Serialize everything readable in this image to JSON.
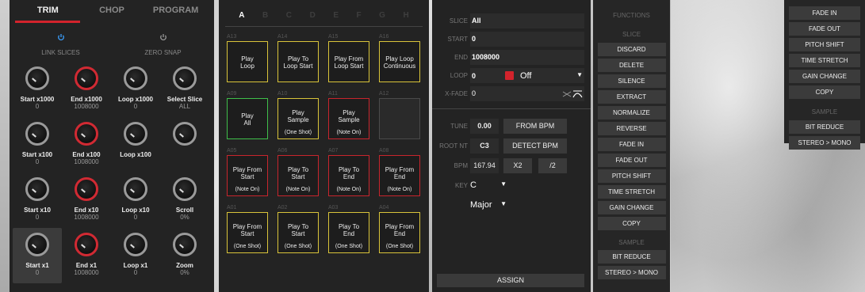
{
  "trim_panel": {
    "tabs": [
      "TRIM",
      "CHOP",
      "PROGRAM"
    ],
    "active_tab": "TRIM",
    "toggles": [
      {
        "label": "LINK SLICES",
        "icon": "power-icon",
        "state": "on",
        "color": "#3aa0ff"
      },
      {
        "label": "ZERO SNAP",
        "icon": "power-icon",
        "state": "off",
        "color": "#9a9a9a"
      }
    ],
    "knobs": [
      {
        "label": "Start x1000",
        "value": "0",
        "accent": "gray"
      },
      {
        "label": "End x1000",
        "value": "1008000",
        "accent": "red"
      },
      {
        "label": "Loop x1000",
        "value": "0",
        "accent": "gray"
      },
      {
        "label": "Select Slice",
        "value": "ALL",
        "accent": "gray"
      },
      {
        "label": "Start x100",
        "value": "0",
        "accent": "gray"
      },
      {
        "label": "End x100",
        "value": "1008000",
        "accent": "red"
      },
      {
        "label": "Loop x100",
        "value": "",
        "accent": "gray"
      },
      {
        "label": "",
        "value": "",
        "accent": "gray"
      },
      {
        "label": "Start x10",
        "value": "0",
        "accent": "gray"
      },
      {
        "label": "End x10",
        "value": "1008000",
        "accent": "red"
      },
      {
        "label": "Loop x10",
        "value": "0",
        "accent": "gray"
      },
      {
        "label": "Scroll",
        "value": "0%",
        "accent": "gray"
      },
      {
        "label": "Start x1",
        "value": "0",
        "accent": "gray"
      },
      {
        "label": "End x1",
        "value": "1008000",
        "accent": "red"
      },
      {
        "label": "Loop x1",
        "value": "0",
        "accent": "gray"
      },
      {
        "label": "Zoom",
        "value": "0%",
        "accent": "gray"
      }
    ],
    "selected_knob": 12
  },
  "pads_panel": {
    "banks": [
      "A",
      "B",
      "C",
      "D",
      "E",
      "F",
      "G",
      "H"
    ],
    "active_bank": "A",
    "pads": [
      {
        "num": "A13",
        "lines": [
          "Play",
          "Loop"
        ],
        "mode": "",
        "color": "yellow"
      },
      {
        "num": "A14",
        "lines": [
          "Play To",
          "Loop Start"
        ],
        "mode": "",
        "color": "yellow"
      },
      {
        "num": "A15",
        "lines": [
          "Play From",
          "Loop Start"
        ],
        "mode": "",
        "color": "yellow"
      },
      {
        "num": "A16",
        "lines": [
          "Play Loop",
          "Continuous"
        ],
        "mode": "",
        "color": "yellow"
      },
      {
        "num": "A09",
        "lines": [
          "Play",
          "All"
        ],
        "mode": "",
        "color": "green"
      },
      {
        "num": "A10",
        "lines": [
          "Play",
          "Sample"
        ],
        "mode": "(One Shot)",
        "color": "yellow"
      },
      {
        "num": "A11",
        "lines": [
          "Play",
          "Sample"
        ],
        "mode": "(Note On)",
        "color": "red"
      },
      {
        "num": "A12",
        "lines": [],
        "mode": "",
        "color": "gray"
      },
      {
        "num": "A05",
        "lines": [
          "Play From",
          "Start"
        ],
        "mode": "(Note On)",
        "color": "red"
      },
      {
        "num": "A06",
        "lines": [
          "Play To",
          "Start"
        ],
        "mode": "(Note On)",
        "color": "red"
      },
      {
        "num": "A07",
        "lines": [
          "Play To",
          "End"
        ],
        "mode": "(Note On)",
        "color": "red"
      },
      {
        "num": "A08",
        "lines": [
          "Play From",
          "End"
        ],
        "mode": "(Note On)",
        "color": "red"
      },
      {
        "num": "A01",
        "lines": [
          "Play From",
          "Start"
        ],
        "mode": "(One Shot)",
        "color": "yellow"
      },
      {
        "num": "A02",
        "lines": [
          "Play To",
          "Start"
        ],
        "mode": "(One Shot)",
        "color": "yellow"
      },
      {
        "num": "A03",
        "lines": [
          "Play To",
          "End"
        ],
        "mode": "(One Shot)",
        "color": "yellow"
      },
      {
        "num": "A04",
        "lines": [
          "Play From",
          "End"
        ],
        "mode": "(One Shot)",
        "color": "yellow"
      }
    ]
  },
  "params_panel": {
    "slice": {
      "label": "SLICE",
      "value": "All"
    },
    "start": {
      "label": "START",
      "value": "0"
    },
    "end": {
      "label": "END",
      "value": "1008000"
    },
    "loop": {
      "label": "LOOP",
      "value": "0",
      "lock_icon": "lock-icon",
      "mode": "Off"
    },
    "xfade": {
      "label": "X-FADE",
      "value": "0"
    },
    "tune": {
      "label": "TUNE",
      "value": "0.00",
      "button": "FROM BPM"
    },
    "root": {
      "label": "ROOT NT",
      "value": "C3",
      "button": "DETECT BPM"
    },
    "bpm": {
      "label": "BPM",
      "value": "167.94",
      "btn1": "X2",
      "btn2": "/2"
    },
    "key": {
      "label": "KEY",
      "value": "C",
      "scale": "Major"
    },
    "assign": "ASSIGN"
  },
  "functions_panel": {
    "title": "FUNCTIONS",
    "slice_section": "SLICE",
    "slice_items": [
      "DISCARD",
      "DELETE",
      "SILENCE",
      "EXTRACT",
      "NORMALIZE",
      "REVERSE",
      "FADE IN",
      "FADE OUT",
      "PITCH SHIFT",
      "TIME STRETCH",
      "GAIN CHANGE",
      "COPY"
    ],
    "sample_section": "SAMPLE",
    "sample_items": [
      "BIT REDUCE",
      "STEREO > MONO"
    ]
  },
  "right_panel": {
    "items": [
      "FADE IN",
      "FADE OUT",
      "PITCH SHIFT",
      "TIME STRETCH",
      "GAIN CHANGE",
      "COPY"
    ],
    "sample_section": "SAMPLE",
    "sample_items": [
      "BIT REDUCE",
      "STEREO > MONO"
    ]
  },
  "colors": {
    "accent": "#d3232c",
    "pad_yellow": "#d9c43a",
    "pad_green": "#3fbf4a",
    "pad_red": "#c8252d",
    "link_blue": "#3aa0ff"
  }
}
